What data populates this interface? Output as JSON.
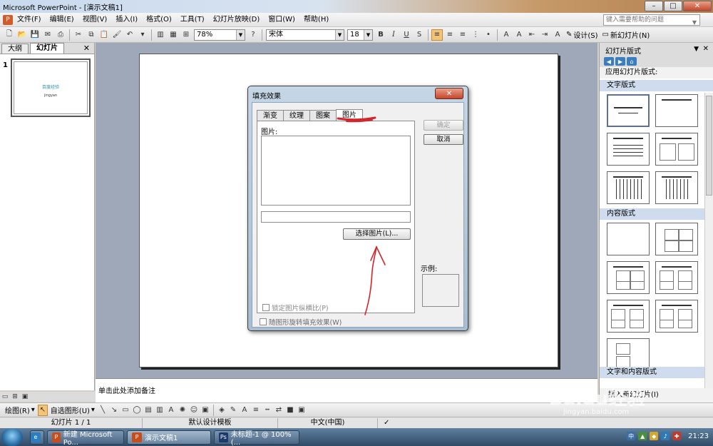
{
  "window": {
    "title": "Microsoft PowerPoint - [演示文稿1]"
  },
  "menu": [
    "文件(F)",
    "编辑(E)",
    "视图(V)",
    "插入(I)",
    "格式(O)",
    "工具(T)",
    "幻灯片放映(D)",
    "窗口(W)",
    "帮助(H)"
  ],
  "help_placeholder": "键入需要帮助的问题",
  "toolbar": {
    "zoom": "78%",
    "font": "宋体",
    "font_size": "18",
    "bold": "B",
    "italic": "I",
    "underline": "U",
    "shadow": "S",
    "grow_font": "A",
    "shrink_font": "A",
    "design": "设计(S)",
    "new_slide": "新幻灯片(N)"
  },
  "left_pane": {
    "tabs": [
      "大纲",
      "幻灯片"
    ],
    "slide_number": "1",
    "thumb_title": "百度经验",
    "thumb_subtitle": "jingyan"
  },
  "notes_placeholder": "单击此处添加备注",
  "task_pane": {
    "title": "幻灯片版式",
    "apply_label": "应用幻灯片版式:",
    "sections": [
      "文字版式",
      "内容版式",
      "文字和内容版式"
    ],
    "footer": "插入新幻灯片(I)"
  },
  "dialog": {
    "title": "填充效果",
    "tabs": [
      "渐变",
      "纹理",
      "图案",
      "图片"
    ],
    "active_tab": "图片",
    "picture_label": "图片:",
    "select_button": "选择图片(L)...",
    "lock_aspect": "锁定图片纵横比(P)",
    "rotate_with_shape": "随图形旋转填充效果(W)",
    "ok": "确定",
    "cancel": "取消",
    "sample_label": "示例:"
  },
  "draw_toolbar": {
    "draw": "绘图(R)",
    "autoshapes": "自选图形(U)"
  },
  "status_bar": {
    "slide": "幻灯片 1 / 1",
    "template": "默认设计模板",
    "language": "中文(中国)"
  },
  "taskbar": {
    "items": [
      "新建 Microsoft Po...",
      "演示文稿1",
      "未标题-1 @ 100%(..."
    ],
    "clock": "21:23"
  },
  "watermark": {
    "brand": "Baidu经验",
    "url": "jingyan.baidu.com"
  },
  "colors": {
    "accent_title": "#2a8ea8",
    "annotation": "#d4232a",
    "slide_bg": "#ffffff",
    "workspace": "#9fa8b9"
  }
}
